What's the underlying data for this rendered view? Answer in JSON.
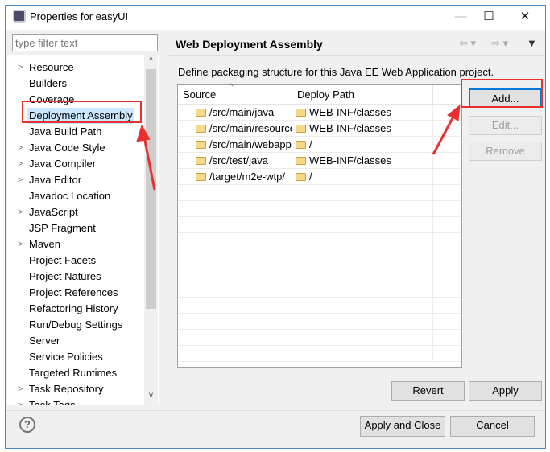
{
  "window": {
    "title": "Properties for easyUI",
    "minimize": "—",
    "maximize": "☐",
    "close": "✕"
  },
  "sidebar": {
    "filter_placeholder": "type filter text",
    "items": [
      {
        "label": "Resource",
        "expandable": true
      },
      {
        "label": "Builders"
      },
      {
        "label": "Coverage"
      },
      {
        "label": "Deployment Assembly",
        "selected": true
      },
      {
        "label": "Java Build Path"
      },
      {
        "label": "Java Code Style",
        "expandable": true
      },
      {
        "label": "Java Compiler",
        "expandable": true
      },
      {
        "label": "Java Editor",
        "expandable": true
      },
      {
        "label": "Javadoc Location"
      },
      {
        "label": "JavaScript",
        "expandable": true
      },
      {
        "label": "JSP Fragment"
      },
      {
        "label": "Maven",
        "expandable": true
      },
      {
        "label": "Project Facets"
      },
      {
        "label": "Project Natures"
      },
      {
        "label": "Project References"
      },
      {
        "label": "Refactoring History"
      },
      {
        "label": "Run/Debug Settings"
      },
      {
        "label": "Server"
      },
      {
        "label": "Service Policies"
      },
      {
        "label": "Targeted Runtimes"
      },
      {
        "label": "Task Repository",
        "expandable": true
      },
      {
        "label": "Task Tags",
        "expandable": true
      }
    ]
  },
  "main": {
    "title": "Web Deployment Assembly",
    "description": "Define packaging structure for this Java EE Web Application project.",
    "table": {
      "headers": [
        "Source",
        "Deploy Path"
      ],
      "rows": [
        [
          "/src/main/java",
          "WEB-INF/classes"
        ],
        [
          "/src/main/resources",
          "WEB-INF/classes"
        ],
        [
          "/src/main/webapp",
          "/"
        ],
        [
          "/src/test/java",
          "WEB-INF/classes"
        ],
        [
          "/target/m2e-wtp/",
          "/"
        ]
      ]
    },
    "buttons": {
      "add": "Add...",
      "edit": "Edit...",
      "remove": "Remove",
      "revert": "Revert",
      "apply": "Apply"
    }
  },
  "footer": {
    "apply_close": "Apply and Close",
    "cancel": "Cancel",
    "help": "?"
  },
  "colors": {
    "highlight": "#e8302f",
    "selection": "#cce8ff",
    "default_button_border": "#0078d7"
  }
}
